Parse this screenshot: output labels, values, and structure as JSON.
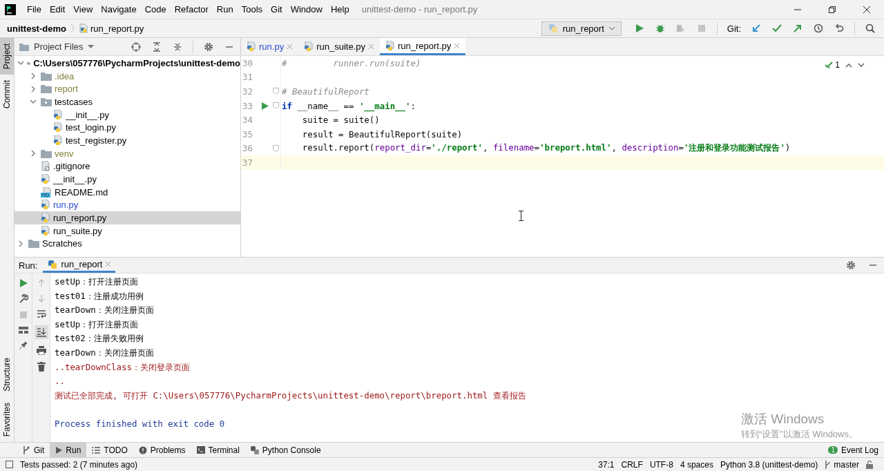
{
  "window": {
    "title": "unittest-demo - run_report.py",
    "menu": [
      {
        "label": "File"
      },
      {
        "label": "Edit"
      },
      {
        "label": "View"
      },
      {
        "label": "Navigate"
      },
      {
        "label": "Code"
      },
      {
        "label": "Refactor"
      },
      {
        "label": "Run"
      },
      {
        "label": "Tools"
      },
      {
        "label": "Git"
      },
      {
        "label": "Window"
      },
      {
        "label": "Help"
      }
    ]
  },
  "breadcrumb": {
    "project": "unittest-demo",
    "file": "run_report.py"
  },
  "toolbar": {
    "run_config": "run_report",
    "git_label": "Git:"
  },
  "side_tabs_top": [
    {
      "label": "Project",
      "selected": true
    },
    {
      "label": "Commit",
      "selected": false
    }
  ],
  "side_tabs_bottom": [
    {
      "label": "Structure"
    },
    {
      "label": "Favorites"
    }
  ],
  "project_panel": {
    "title": "Project Files",
    "tree": [
      {
        "label": "C:\\Users\\057776\\PycharmProjects\\unittest-demo",
        "kind": "folder",
        "expanded": true,
        "selected": false,
        "children": [
          {
            "label": ".idea",
            "kind": "folder",
            "expanded": false,
            "selected": false,
            "color": "#82803a"
          },
          {
            "label": "report",
            "kind": "folder",
            "expanded": false,
            "selected": false,
            "color": "#82803a"
          },
          {
            "label": "testcases",
            "kind": "package",
            "expanded": true,
            "selected": false,
            "children": [
              {
                "label": "__init__.py",
                "kind": "python",
                "selected": false
              },
              {
                "label": "test_login.py",
                "kind": "python",
                "selected": false
              },
              {
                "label": "test_register.py",
                "kind": "python",
                "selected": false
              }
            ]
          },
          {
            "label": "venv",
            "kind": "folder",
            "expanded": false,
            "selected": false,
            "color": "#82803a"
          },
          {
            "label": ".gitignore",
            "kind": "ignore",
            "selected": false
          },
          {
            "label": "__init__.py",
            "kind": "python",
            "selected": false
          },
          {
            "label": "README.md",
            "kind": "markdown",
            "selected": false
          },
          {
            "label": "run.py",
            "kind": "python",
            "selected": false,
            "color": "#2a4bd0"
          },
          {
            "label": "run_report.py",
            "kind": "python",
            "selected": true
          },
          {
            "label": "run_suite.py",
            "kind": "python",
            "selected": false
          }
        ]
      },
      {
        "label": "Scratches",
        "kind": "folder",
        "expanded": false,
        "selected": false
      }
    ]
  },
  "editor": {
    "tabs": [
      {
        "label": "run.py",
        "selected": false,
        "color": "#2a4bd0"
      },
      {
        "label": "run_suite.py",
        "selected": false,
        "color": "#000000"
      },
      {
        "label": "run_report.py",
        "selected": true,
        "color": "#000000"
      }
    ],
    "inspection_count": "1",
    "lines": [
      {
        "number": "30",
        "current": false,
        "run_marker": false,
        "fold": false,
        "tokens": [
          {
            "kind": "comment",
            "text": "#         runner.run(suite)"
          }
        ]
      },
      {
        "number": "31",
        "current": false,
        "run_marker": false,
        "fold": false
      },
      {
        "number": "32",
        "current": false,
        "run_marker": false,
        "fold": true,
        "tokens": [
          {
            "kind": "comment",
            "text": "# BeautifulReport"
          }
        ]
      },
      {
        "number": "33",
        "current": false,
        "run_marker": true,
        "fold": true,
        "tokens": [
          {
            "kind": "keyword",
            "text": "if"
          },
          {
            "kind": "plain",
            "text": " __name__ == "
          },
          {
            "kind": "string",
            "text": "'__main__'"
          },
          {
            "kind": "plain",
            "text": ":"
          }
        ]
      },
      {
        "number": "34",
        "current": false,
        "run_marker": false,
        "fold": false,
        "tokens": [
          {
            "kind": "plain",
            "text": "    suite = suite()"
          }
        ]
      },
      {
        "number": "35",
        "current": false,
        "run_marker": false,
        "fold": false,
        "tokens": [
          {
            "kind": "plain",
            "text": "    result = BeautifulReport(suite)"
          }
        ]
      },
      {
        "number": "36",
        "current": false,
        "run_marker": false,
        "fold": true,
        "tokens": [
          {
            "kind": "plain",
            "text": "    result.report("
          },
          {
            "kind": "param",
            "text": "report_dir"
          },
          {
            "kind": "plain",
            "text": "="
          },
          {
            "kind": "string",
            "text": "'./report'"
          },
          {
            "kind": "plain",
            "text": ", "
          },
          {
            "kind": "param",
            "text": "filename"
          },
          {
            "kind": "plain",
            "text": "="
          },
          {
            "kind": "string",
            "text": "'breport.html'"
          },
          {
            "kind": "plain",
            "text": ", "
          },
          {
            "kind": "param",
            "text": "description"
          },
          {
            "kind": "plain",
            "text": "="
          },
          {
            "kind": "string",
            "text": "'注册和登录功能测试报告'"
          },
          {
            "kind": "plain",
            "text": ")"
          }
        ]
      },
      {
        "number": "37",
        "current": true,
        "run_marker": false,
        "fold": false
      }
    ]
  },
  "run_panel": {
    "label": "Run:",
    "tab": "run_report",
    "lines": [
      {
        "kind": "stdout",
        "text": "setUp：打开注册页面"
      },
      {
        "kind": "stdout",
        "text": "test01：注册成功用例"
      },
      {
        "kind": "stdout",
        "text": "tearDown：关闭注册页面"
      },
      {
        "kind": "stdout",
        "text": "setUp：打开注册页面"
      },
      {
        "kind": "stdout",
        "text": "test02：注册失败用例"
      },
      {
        "kind": "stdout",
        "text": "tearDown：关闭注册页面"
      },
      {
        "kind": "stderr",
        "text": "..tearDownClass：关闭登录页面"
      },
      {
        "kind": "stderr",
        "text": ".."
      },
      {
        "kind": "stderr",
        "text": "测试已全部完成, 可打开 C:\\Users\\057776\\PycharmProjects\\unittest-demo\\report\\breport.html 查看报告"
      },
      {
        "kind": "exit",
        "text": "Process finished with exit code 0"
      }
    ]
  },
  "activation_notice": {
    "title": "激活 Windows",
    "hint": "转到“设置”以激活 Windows。"
  },
  "tool_tabs": [
    {
      "label": "Git",
      "kind": "git",
      "selected": false
    },
    {
      "label": "Run",
      "kind": "run",
      "selected": true
    },
    {
      "label": "TODO",
      "kind": "todo",
      "selected": false
    },
    {
      "label": "Problems",
      "kind": "problems",
      "selected": false
    },
    {
      "label": "Terminal",
      "kind": "terminal",
      "selected": false
    },
    {
      "label": "Python Console",
      "kind": "python",
      "selected": false
    }
  ],
  "event_log": {
    "label": "Event Log",
    "count": "1"
  },
  "status_bar": {
    "message": "Tests passed: 2 (7 minutes ago)",
    "items": [
      "37:1",
      "CRLF",
      "UTF-8",
      "4 spaces",
      "Python 3.8 (unittest-demo)"
    ],
    "branch": "master"
  }
}
